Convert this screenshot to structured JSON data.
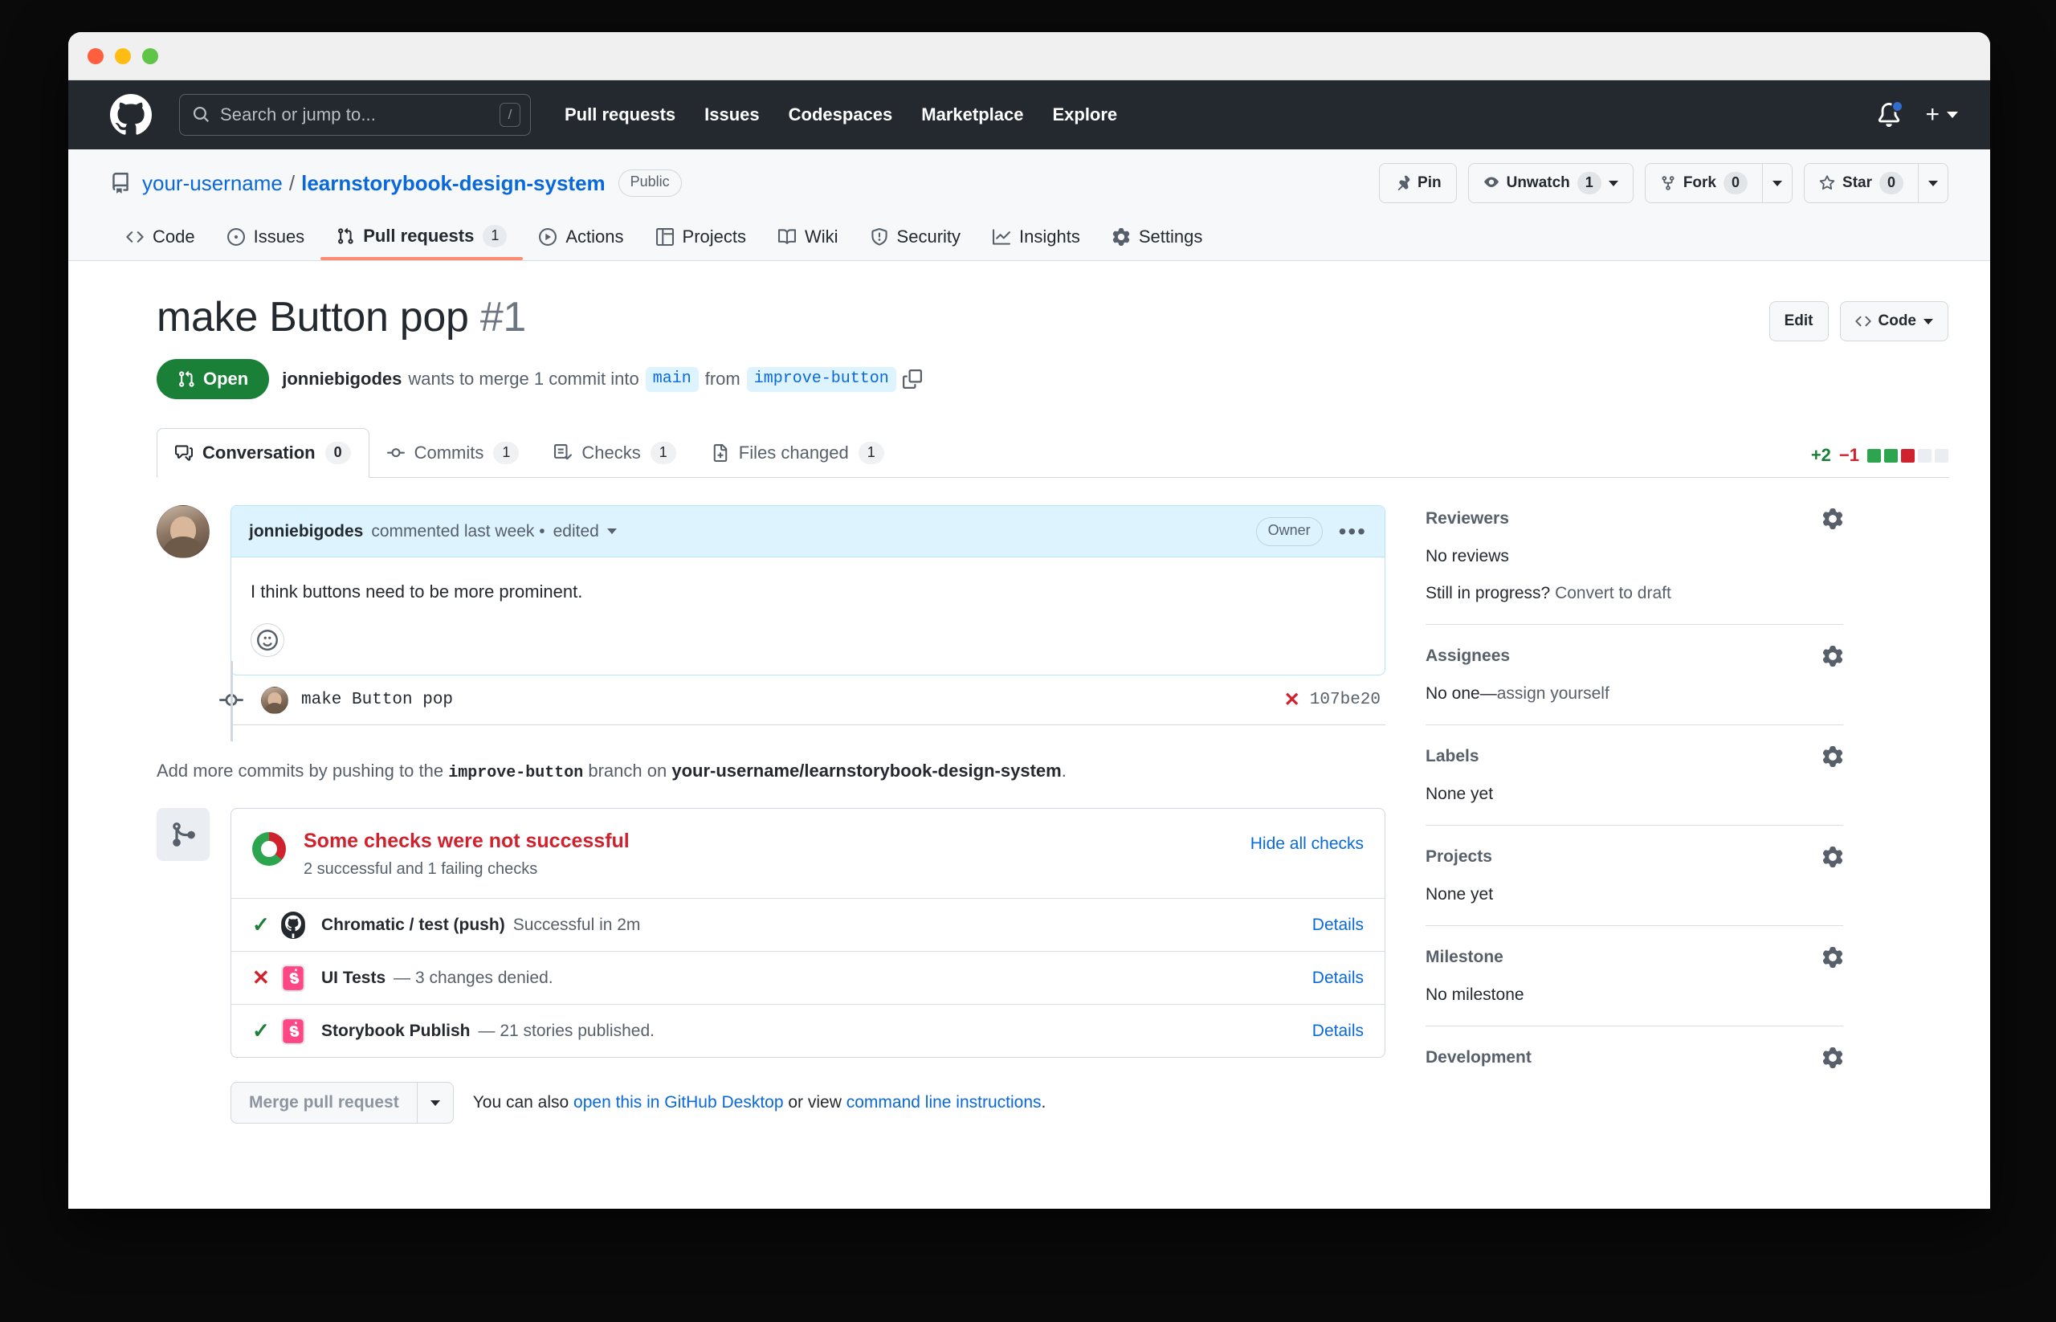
{
  "window": {
    "traffic_lights": [
      "close",
      "minimize",
      "maximize"
    ]
  },
  "gh_header": {
    "logo_icon": "github-mark-icon",
    "search": {
      "placeholder": "Search or jump to...",
      "value": "",
      "shortcut_key": "/"
    },
    "nav": [
      {
        "label": "Pull requests"
      },
      {
        "label": "Issues"
      },
      {
        "label": "Codespaces"
      },
      {
        "label": "Marketplace"
      },
      {
        "label": "Explore"
      }
    ],
    "notifications_icon": "bell-icon",
    "create_new_label": "+"
  },
  "repo": {
    "icon": "repo-icon",
    "owner": "your-username",
    "separator": "/",
    "name": "learnstorybook-design-system",
    "visibility": "Public",
    "actions": {
      "pin": {
        "label": "Pin",
        "icon": "pin-icon"
      },
      "watch": {
        "label": "Unwatch",
        "count": "1",
        "icon": "eye-icon"
      },
      "fork": {
        "label": "Fork",
        "count": "0",
        "icon": "fork-icon"
      },
      "star": {
        "label": "Star",
        "count": "0",
        "icon": "star-icon"
      }
    },
    "tabs": [
      {
        "label": "Code",
        "icon": "code-icon",
        "count": "",
        "active": false
      },
      {
        "label": "Issues",
        "icon": "issue-opened-icon",
        "count": "",
        "active": false
      },
      {
        "label": "Pull requests",
        "icon": "git-pull-request-icon",
        "count": "1",
        "active": true
      },
      {
        "label": "Actions",
        "icon": "play-icon",
        "count": "",
        "active": false
      },
      {
        "label": "Projects",
        "icon": "table-icon",
        "count": "",
        "active": false
      },
      {
        "label": "Wiki",
        "icon": "book-icon",
        "count": "",
        "active": false
      },
      {
        "label": "Security",
        "icon": "shield-icon",
        "count": "",
        "active": false
      },
      {
        "label": "Insights",
        "icon": "graph-icon",
        "count": "",
        "active": false
      },
      {
        "label": "Settings",
        "icon": "gear-icon",
        "count": "",
        "active": false
      }
    ]
  },
  "pull_request": {
    "title": "make Button pop",
    "number": "#1",
    "edit_label": "Edit",
    "code_label": "Code",
    "state": "Open",
    "state_icon": "git-pull-request-icon",
    "author": "jonniebigodes",
    "merge_text_1": "wants to merge 1 commit into",
    "base_branch": "main",
    "merge_text_2": "from",
    "head_branch": "improve-button",
    "copy_icon": "copy-icon",
    "tabs": [
      {
        "label": "Conversation",
        "count": "0",
        "icon": "comment-discussion-icon",
        "active": true
      },
      {
        "label": "Commits",
        "count": "1",
        "icon": "git-commit-icon",
        "active": false
      },
      {
        "label": "Checks",
        "count": "1",
        "icon": "checklist-icon",
        "active": false
      },
      {
        "label": "Files changed",
        "count": "1",
        "icon": "file-diff-icon",
        "active": false
      }
    ],
    "diffstat": {
      "additions": "+2",
      "deletions": "−1",
      "blocks": [
        "g",
        "g",
        "r",
        "n",
        "n"
      ]
    }
  },
  "comment": {
    "avatar": "avatar",
    "author": "jonniebigodes",
    "meta": "commented last week •",
    "edited": "edited",
    "badge": "Owner",
    "kebab_icon": "kebab-horizontal-icon",
    "body": "I think buttons need to be more prominent.",
    "reaction_icon": "smiley-icon"
  },
  "commit": {
    "node_icon": "git-commit-icon",
    "message": "make Button pop",
    "status_icon": "x-icon",
    "sha": "107be20"
  },
  "add_commits_note": {
    "prefix": "Add more commits by pushing to the",
    "branch": "improve-button",
    "middle": "branch on",
    "repo": "your-username/learnstorybook-design-system",
    "suffix": "."
  },
  "checks": {
    "box_icon": "git-merge-icon",
    "title": "Some checks were not successful",
    "subtitle": "2 successful and 1 failing checks",
    "hide_all_label": "Hide all checks",
    "items": [
      {
        "status": "success",
        "status_glyph": "✓",
        "logo": "github-logo-icon",
        "name": "Chromatic / test (push)",
        "description": "Successful in 2m",
        "details_label": "Details"
      },
      {
        "status": "failure",
        "status_glyph": "✕",
        "logo": "chromatic-logo-icon",
        "name": "UI Tests",
        "description": "— 3 changes denied.",
        "details_label": "Details"
      },
      {
        "status": "success",
        "status_glyph": "✓",
        "logo": "chromatic-logo-icon",
        "name": "Storybook Publish",
        "description": "— 21 stories published.",
        "details_label": "Details"
      }
    ]
  },
  "merge": {
    "button_label": "Merge pull request",
    "note_prefix": "You can also",
    "note_link_1": "open this in GitHub Desktop",
    "note_middle": "or view",
    "note_link_2": "command line instructions",
    "note_suffix": "."
  },
  "sidebar": [
    {
      "title": "Reviewers",
      "gear_icon": "gear-icon",
      "body_strong": "No reviews",
      "body_extra_strong": "Still in progress?",
      "body_link": "Convert to draft"
    },
    {
      "title": "Assignees",
      "gear_icon": "gear-icon",
      "body_strong": "No one—",
      "body_link": "assign yourself"
    },
    {
      "title": "Labels",
      "gear_icon": "gear-icon",
      "body_strong": "None yet"
    },
    {
      "title": "Projects",
      "gear_icon": "gear-icon",
      "body_strong": "None yet"
    },
    {
      "title": "Milestone",
      "gear_icon": "gear-icon",
      "body_strong": "No milestone"
    },
    {
      "title": "Development",
      "gear_icon": "gear-icon",
      "body_strong": ""
    }
  ],
  "colors": {
    "header_bg": "#24292f",
    "accent_blue": "#0969da",
    "open_green": "#1a7f37",
    "fail_red": "#cf222e",
    "tab_underline": "#fd8c73",
    "comment_header_bg": "#ddf4ff"
  }
}
